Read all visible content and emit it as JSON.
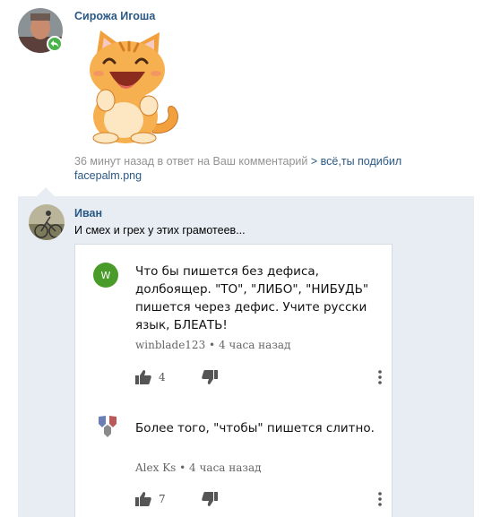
{
  "notification": {
    "author": "Сирожа Игоша",
    "meta_prefix": "36 минут назад в ответ на Ваш комментарий",
    "meta_link": "> всё,ты подибил",
    "meta_file": "facepalm.png"
  },
  "reply": {
    "author": "Иван",
    "text": "И смех и грех у этих грамотеев..."
  },
  "embedded_comments": [
    {
      "avatar_letter": "W",
      "text": "Что бы пишется без дефиса, долбоящер. \"ТО\", \"ЛИБО\", \"НИБУДЬ\" пишется через дефис. Учите русски язык, БЛЕАТЬ!",
      "author": "winblade123",
      "time": "4 часа назад",
      "likes": "4"
    },
    {
      "avatar_letter": "",
      "text": "Более того, \"чтобы\" пишется слитно.",
      "author": "Alex Ks",
      "time": "4 часа назад",
      "likes": "7"
    }
  ],
  "separator": "•",
  "colors": {
    "link": "#2a5885",
    "highlight_bg": "#e7edf3",
    "badge_green": "#4bb34b",
    "sticker_orange": "#f2a03d"
  },
  "icons": [
    "reply-badge-icon",
    "thumb-up-icon",
    "thumb-down-icon",
    "more-vertical-icon"
  ]
}
